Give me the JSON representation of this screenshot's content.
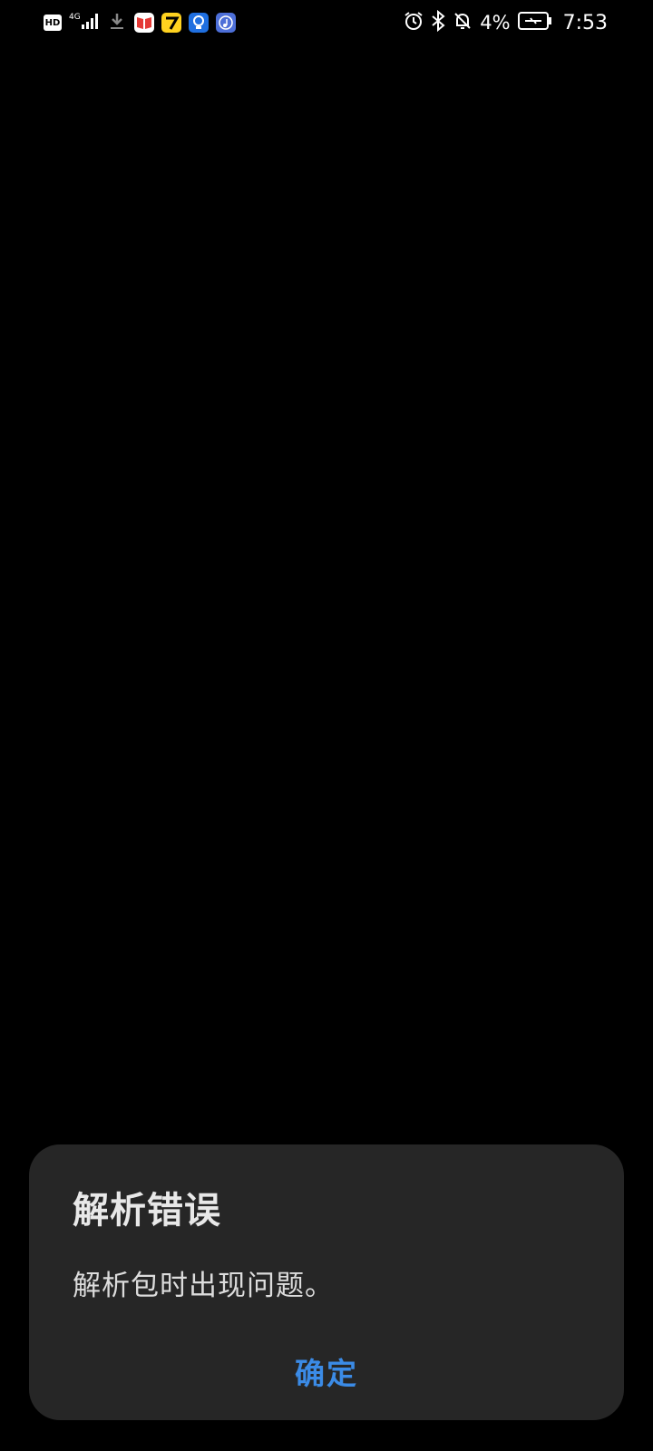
{
  "status_bar": {
    "network_badge": "HD",
    "network_type": "4G",
    "battery_percent": "4%",
    "time": "7:53"
  },
  "dialog": {
    "title": "解析错误",
    "message": "解析包时出现问题。",
    "confirm_label": "确定"
  },
  "colors": {
    "background": "#000000",
    "dialog_bg": "#262626",
    "accent": "#3b8be6"
  }
}
